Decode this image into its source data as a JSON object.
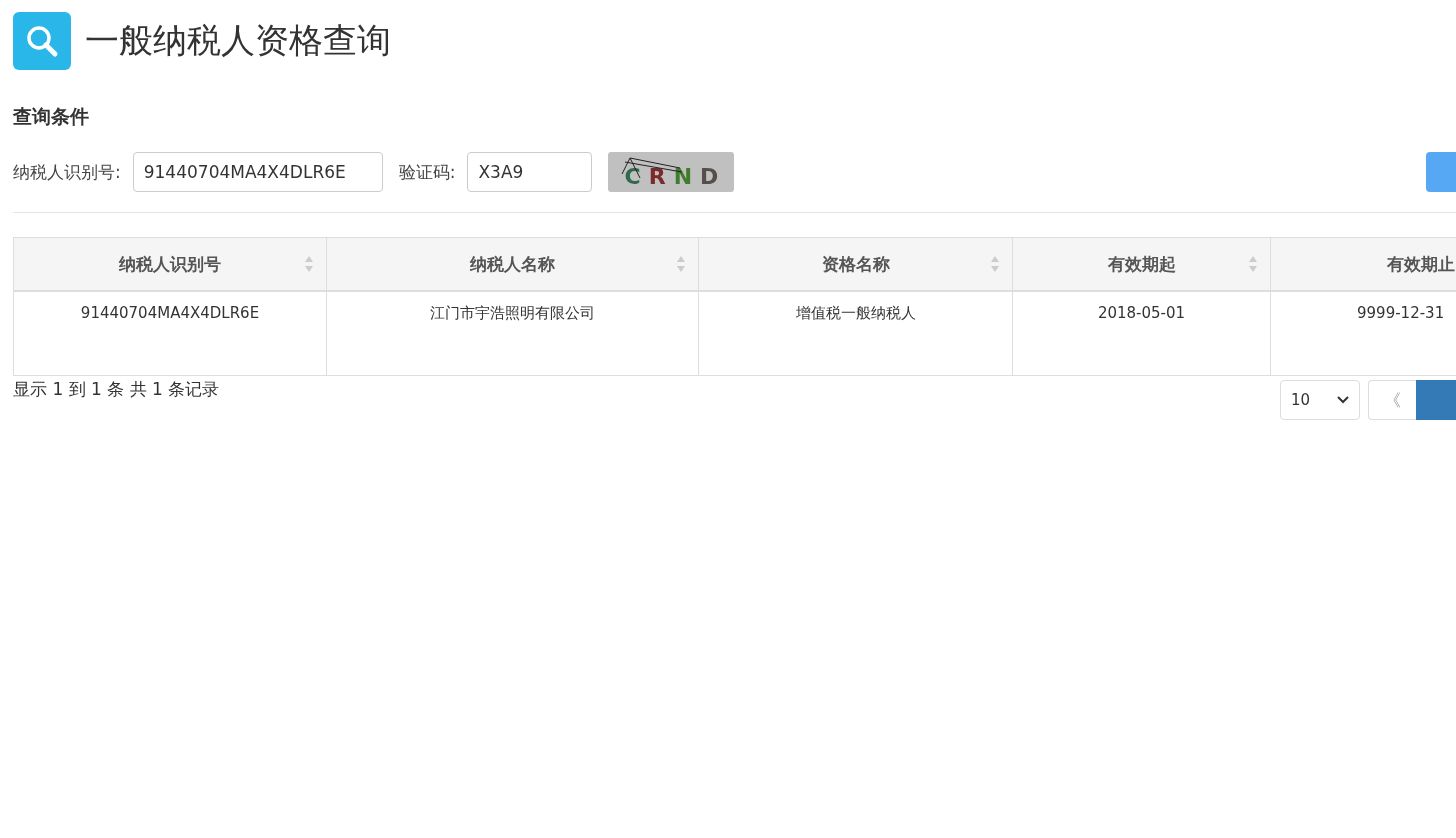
{
  "header": {
    "title": "一般纳税人资格查询"
  },
  "query": {
    "section_title": "查询条件",
    "fields": [
      {
        "label": "纳税人识别号:",
        "value": "91440704MA4X4DLR6E",
        "kind": "text"
      },
      {
        "label": "验证码:",
        "value": "X3A9",
        "kind": "captcha"
      }
    ],
    "captcha": [
      {
        "char": "C",
        "color": "#2f6a4c"
      },
      {
        "char": "R",
        "color": "#7b2b2b"
      },
      {
        "char": "N",
        "color": "#3f7d2c"
      },
      {
        "char": "D",
        "color": "#555047"
      }
    ]
  },
  "table": {
    "columns": [
      {
        "label": "纳税人识别号",
        "sortable": true
      },
      {
        "label": "纳税人名称",
        "sortable": true
      },
      {
        "label": "资格名称",
        "sortable": true
      },
      {
        "label": "有效期起",
        "sortable": true
      },
      {
        "label": "有效期止"
      }
    ],
    "rows": [
      {
        "cells": [
          "91440704MA4X4DLR6E",
          "江门市宇浩照明有限公司",
          "增值税一般纳税人",
          "2018-05-01",
          "9999-12-31"
        ]
      }
    ]
  },
  "footer": {
    "summary": "显示 1 到 1 条 共 1 条记录",
    "page_size": "10",
    "prev": "《"
  }
}
